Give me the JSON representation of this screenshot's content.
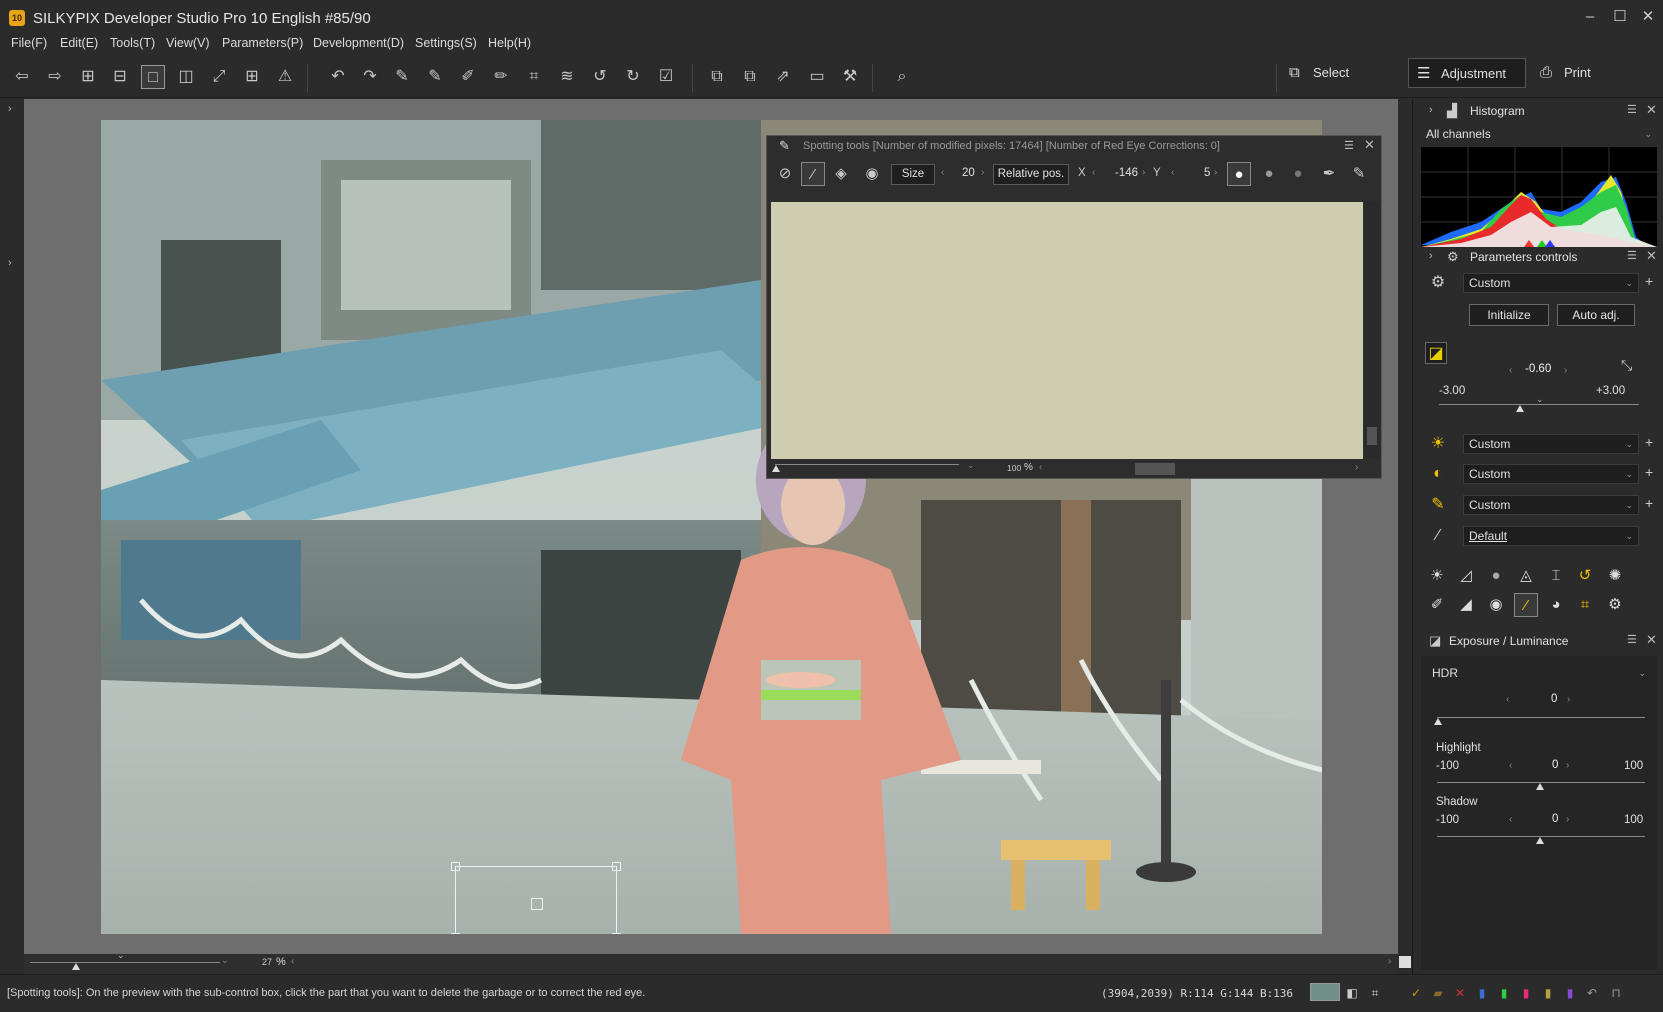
{
  "window": {
    "title": "SILKYPIX Developer Studio Pro 10 English   #85/90",
    "app_icon_text": "10",
    "controls": [
      "–",
      "☐",
      "✕"
    ]
  },
  "menu": [
    "File(F)",
    "Edit(E)",
    "Tools(T)",
    "View(V)",
    "Parameters(P)",
    "Development(D)",
    "Settings(S)",
    "Help(H)"
  ],
  "modes": {
    "select": "Select",
    "adjustment": "Adjustment",
    "print": "Print"
  },
  "spotting": {
    "title": "Spotting tools [Number of modified pixels: 17464]  [Number of Red Eye Corrections: 0]",
    "size_label": "Size",
    "size_value": "20",
    "relpos_label": "Relative pos.",
    "x_label": "X",
    "x_value": "-146",
    "y_label": "Y",
    "y_value": "5",
    "zoom_value": "100",
    "zoom_unit": "%"
  },
  "preview": {
    "zoom_value": "27",
    "zoom_unit": "%"
  },
  "status": {
    "message": "[Spotting tools]: On the preview with the sub-control box, click the part that you want to delete the garbage or to correct the red eye.",
    "coords": "(3904,2039) R:114 G:144 B:136",
    "swatch_color": "#72908a"
  },
  "histogram": {
    "title": "Histogram",
    "channel": "All channels"
  },
  "params": {
    "title": "Parameters controls",
    "preset": "Custom",
    "initialize": "Initialize",
    "auto_adj": "Auto adj.",
    "exposure_value": "-0.60",
    "exposure_min": "-3.00",
    "exposure_max": "+3.00",
    "wb": "Custom",
    "tone": "Custom",
    "sharp": "Custom",
    "taste": "Default"
  },
  "exposure_panel": {
    "title": "Exposure / Luminance",
    "hdr_label": "HDR",
    "hdr_value": "0",
    "highlight_label": "Highlight",
    "highlight_min": "-100",
    "highlight_value": "0",
    "highlight_max": "100",
    "shadow_label": "Shadow",
    "shadow_min": "-100",
    "shadow_value": "0",
    "shadow_max": "100"
  }
}
